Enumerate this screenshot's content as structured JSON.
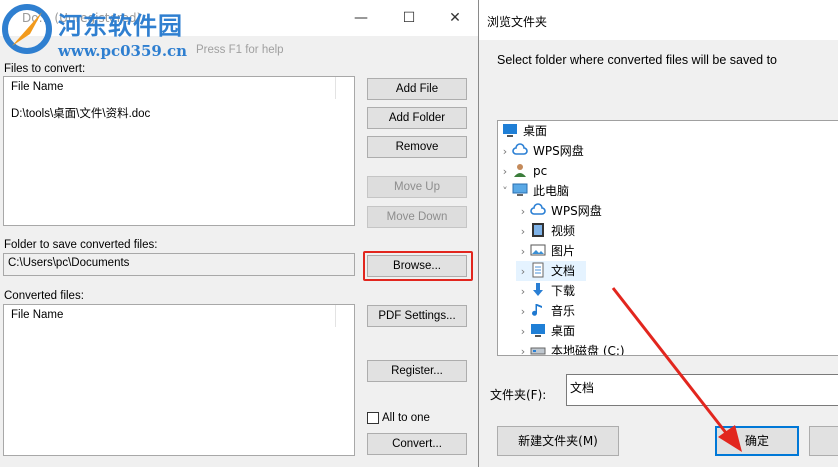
{
  "converter": {
    "title": "Do… (Unregistered)",
    "help_hint": "Press F1 for help",
    "watermark": {
      "name": "河东软件园",
      "url": "www.pc0359.cn"
    },
    "files_to_convert_label": "Files to convert:",
    "files_list": {
      "header": "File Name",
      "rows": [
        "D:\\tools\\桌面\\文件\\资料.doc"
      ]
    },
    "folder_label": "Folder to save converted files:",
    "folder_value": "C:\\Users\\pc\\Documents",
    "converted_label": "Converted files:",
    "converted_list": {
      "header": "File Name",
      "rows": []
    },
    "buttons": {
      "add_file": "Add File",
      "add_folder": "Add Folder",
      "remove": "Remove",
      "move_up": "Move Up",
      "move_down": "Move Down",
      "browse": "Browse...",
      "pdf_settings": "PDF Settings...",
      "register": "Register...",
      "convert": "Convert..."
    },
    "all_to_one": {
      "label": "All to one",
      "checked": false
    }
  },
  "dialog": {
    "title": "浏览文件夹",
    "description": "Select folder where converted files will be saved to",
    "tree": [
      {
        "label": "桌面",
        "icon": "desktop-icon",
        "level": 0,
        "expander": "none"
      },
      {
        "label": "WPS网盘",
        "icon": "cloud-icon",
        "level": 1,
        "expander": "collapsed"
      },
      {
        "label": "pc",
        "icon": "user-icon",
        "level": 1,
        "expander": "collapsed"
      },
      {
        "label": "此电脑",
        "icon": "computer-icon",
        "level": 1,
        "expander": "expanded"
      },
      {
        "label": "WPS网盘",
        "icon": "cloud-icon",
        "level": 2,
        "expander": "collapsed"
      },
      {
        "label": "视频",
        "icon": "video-folder-icon",
        "level": 2,
        "expander": "collapsed"
      },
      {
        "label": "图片",
        "icon": "picture-folder-icon",
        "level": 2,
        "expander": "collapsed"
      },
      {
        "label": "文档",
        "icon": "document-folder-icon",
        "level": 2,
        "expander": "collapsed",
        "selected": true
      },
      {
        "label": "下载",
        "icon": "download-icon",
        "level": 2,
        "expander": "collapsed"
      },
      {
        "label": "音乐",
        "icon": "music-icon",
        "level": 2,
        "expander": "collapsed"
      },
      {
        "label": "桌面",
        "icon": "desktop-icon",
        "level": 2,
        "expander": "collapsed"
      },
      {
        "label": "本地磁盘 (C:)",
        "icon": "drive-icon",
        "level": 2,
        "expander": "collapsed"
      }
    ],
    "folder_label": "文件夹(F):",
    "folder_value": "文档",
    "buttons": {
      "new_folder": "新建文件夹(M)",
      "ok": "确定"
    }
  },
  "colors": {
    "highlight": "#e2261e",
    "accent": "#0078d7",
    "watermark": "#2f7fd0"
  }
}
